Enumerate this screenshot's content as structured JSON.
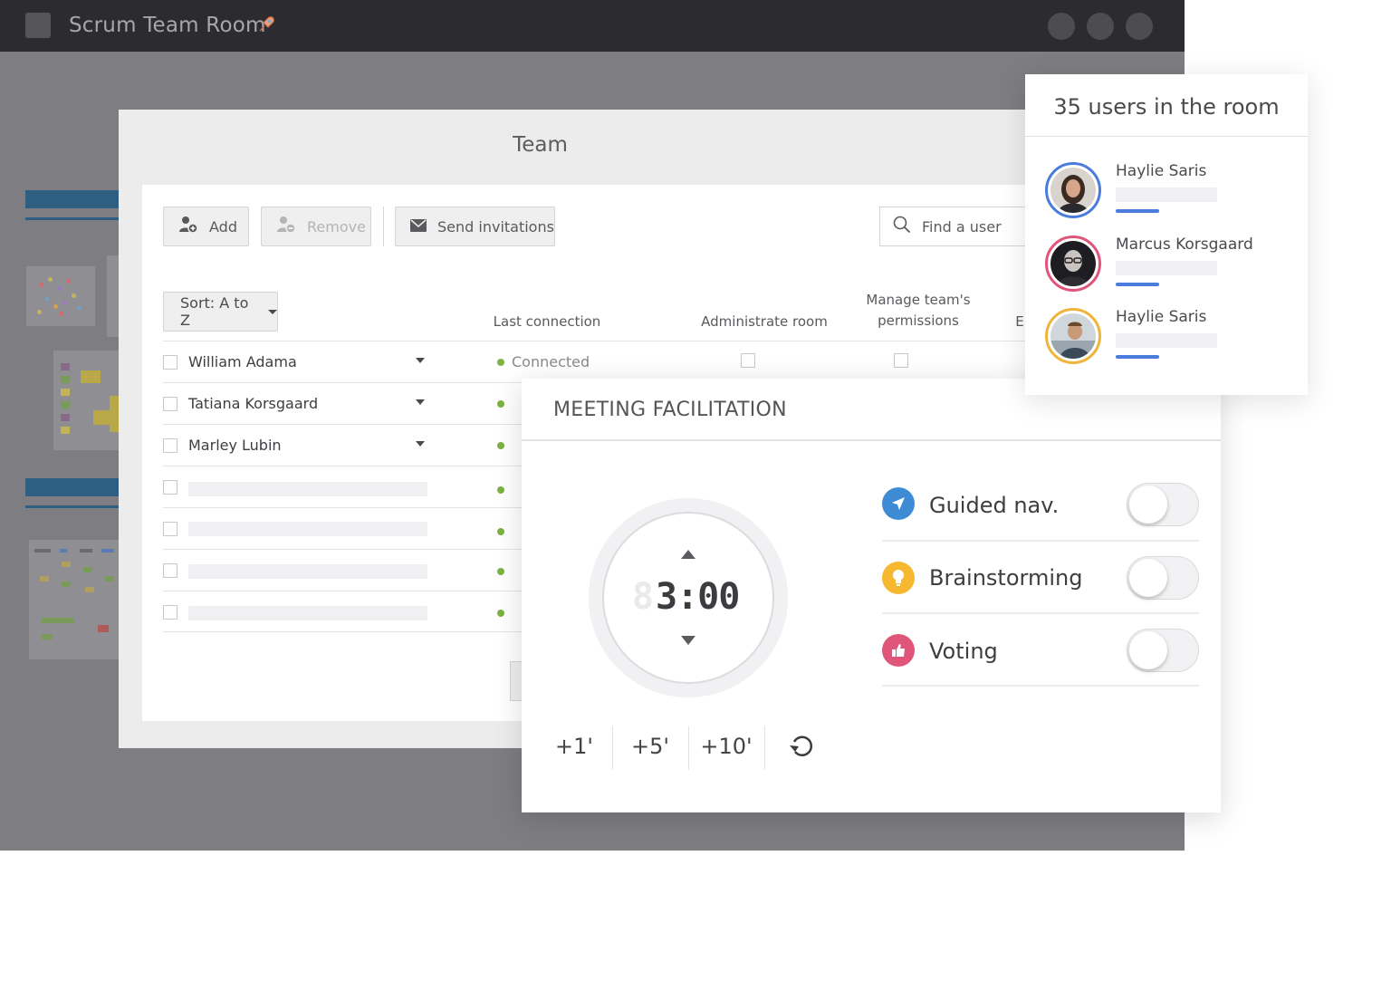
{
  "window": {
    "title": "Scrum Team Room",
    "title_icon": "rocket-icon"
  },
  "team": {
    "title": "Team",
    "toolbar": {
      "add_label": "Add",
      "remove_label": "Remove",
      "send_label": "Send invitations",
      "search_placeholder": "Find a user"
    },
    "sort_label": "Sort: A to Z",
    "columns": {
      "last_connection": "Last connection",
      "administrate": "Administrate room",
      "manage_line1": "Manage team's",
      "manage_line2": "permissions",
      "truncated": "E"
    },
    "rows": [
      {
        "name": "William Adama",
        "status": "Connected"
      },
      {
        "name": "Tatiana Korsgaard",
        "status": ""
      },
      {
        "name": "Marley Lubin",
        "status": ""
      }
    ]
  },
  "meeting": {
    "title": "MEETING FACILITATION",
    "timer": {
      "ghost": "8",
      "value": "3:00"
    },
    "add_buttons": [
      "+1'",
      "+5'",
      "+10'"
    ],
    "reset_icon": "reset-icon",
    "features": [
      {
        "label": "Guided nav.",
        "icon": "navigation-arrow-icon",
        "color": "#3d8bd4",
        "enabled": false
      },
      {
        "label": "Brainstorming",
        "icon": "lightbulb-icon",
        "color": "#f5b82e",
        "enabled": false
      },
      {
        "label": "Voting",
        "icon": "thumbs-up-icon",
        "color": "#e0557a",
        "enabled": false
      }
    ]
  },
  "users_panel": {
    "title": "35 users in the room",
    "users": [
      {
        "name": "Haylie Saris",
        "ring": "#4a7cdc"
      },
      {
        "name": "Marcus Korsgaard",
        "ring": "#e0557a"
      },
      {
        "name": "Haylie Saris",
        "ring": "#f0b43c"
      }
    ]
  },
  "colors": {
    "connected": "#7cb342",
    "accent_blue": "#4a7cdc"
  }
}
